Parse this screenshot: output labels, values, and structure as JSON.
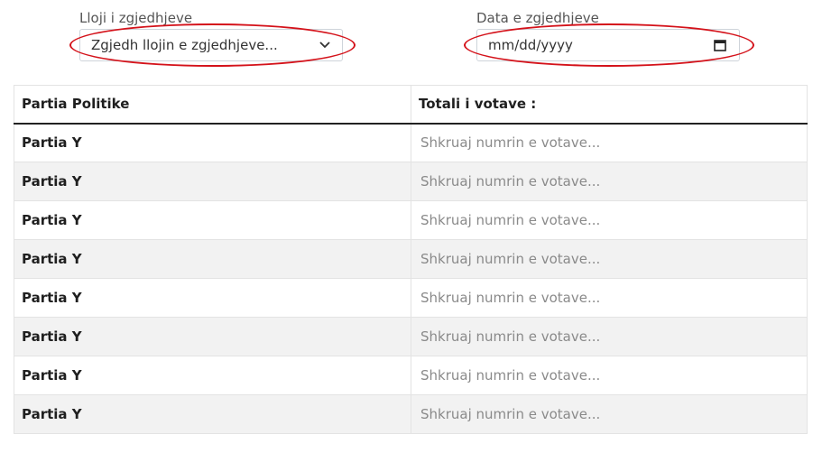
{
  "election_type": {
    "label": "Lloji i zgjedhjeve",
    "selected": "Zgjedh llojin e zgjedhjeve..."
  },
  "election_date": {
    "label": "Data e zgjedhjeve",
    "placeholder": "mm/dd/yyyy"
  },
  "table": {
    "headers": [
      "Partia Politike",
      "Totali i votave :"
    ],
    "rows": [
      {
        "party": "Partia Y",
        "votes_placeholder": "Shkruaj numrin e votave..."
      },
      {
        "party": "Partia Y",
        "votes_placeholder": "Shkruaj numrin e votave..."
      },
      {
        "party": "Partia Y",
        "votes_placeholder": "Shkruaj numrin e votave..."
      },
      {
        "party": "Partia Y",
        "votes_placeholder": "Shkruaj numrin e votave..."
      },
      {
        "party": "Partia Y",
        "votes_placeholder": "Shkruaj numrin e votave..."
      },
      {
        "party": "Partia Y",
        "votes_placeholder": "Shkruaj numrin e votave..."
      },
      {
        "party": "Partia Y",
        "votes_placeholder": "Shkruaj numrin e votave..."
      },
      {
        "party": "Partia Y",
        "votes_placeholder": "Shkruaj numrin e votave..."
      }
    ]
  },
  "annotations": {
    "oval_color": "#d4121a"
  },
  "icons": {
    "select": "chevron-down-icon",
    "date": "calendar-icon"
  }
}
